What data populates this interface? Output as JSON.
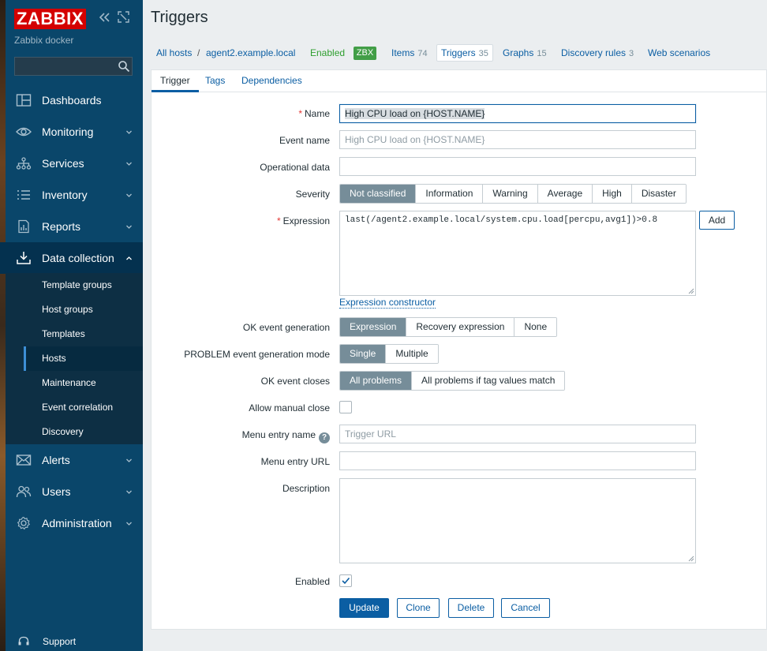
{
  "sidebar": {
    "logo": "ZABBIX",
    "server_name": "Zabbix docker",
    "search_value": "",
    "items": [
      {
        "label": "Dashboards"
      },
      {
        "label": "Monitoring"
      },
      {
        "label": "Services"
      },
      {
        "label": "Inventory"
      },
      {
        "label": "Reports"
      },
      {
        "label": "Data collection"
      },
      {
        "label": "Alerts"
      },
      {
        "label": "Users"
      },
      {
        "label": "Administration"
      }
    ],
    "data_collection_sub": [
      {
        "label": "Template groups"
      },
      {
        "label": "Host groups"
      },
      {
        "label": "Templates"
      },
      {
        "label": "Hosts"
      },
      {
        "label": "Maintenance"
      },
      {
        "label": "Event correlation"
      },
      {
        "label": "Discovery"
      }
    ],
    "support": "Support"
  },
  "page": {
    "title": "Triggers"
  },
  "breadcrumbs": {
    "all_hosts": "All hosts",
    "separator": "/",
    "host": "agent2.example.local",
    "enabled": "Enabled",
    "zbx": "ZBX",
    "items": {
      "label": "Items",
      "count": "74"
    },
    "triggers": {
      "label": "Triggers",
      "count": "35"
    },
    "graphs": {
      "label": "Graphs",
      "count": "15"
    },
    "discovery": {
      "label": "Discovery rules",
      "count": "3"
    },
    "web": {
      "label": "Web scenarios"
    }
  },
  "tabs": {
    "trigger": "Trigger",
    "tags": "Tags",
    "dependencies": "Dependencies"
  },
  "form": {
    "required_mark": "*",
    "name": {
      "label": "Name",
      "value": "High CPU load on {HOST.NAME}"
    },
    "event_name": {
      "label": "Event name",
      "placeholder": "High CPU load on {HOST.NAME}"
    },
    "operational_data": {
      "label": "Operational data",
      "value": ""
    },
    "severity": {
      "label": "Severity",
      "options": [
        "Not classified",
        "Information",
        "Warning",
        "Average",
        "High",
        "Disaster"
      ],
      "selected": "Not classified"
    },
    "expression": {
      "label": "Expression",
      "value": "last(/agent2.example.local/system.cpu.load[percpu,avg1])>0.8",
      "add_button": "Add",
      "constructor_link": "Expression constructor"
    },
    "ok_event_generation": {
      "label": "OK event generation",
      "options": [
        "Expression",
        "Recovery expression",
        "None"
      ],
      "selected": "Expression"
    },
    "problem_mode": {
      "label": "PROBLEM event generation mode",
      "options": [
        "Single",
        "Multiple"
      ],
      "selected": "Single"
    },
    "ok_event_closes": {
      "label": "OK event closes",
      "options": [
        "All problems",
        "All problems if tag values match"
      ],
      "selected": "All problems"
    },
    "allow_manual_close": {
      "label": "Allow manual close",
      "checked": false
    },
    "menu_entry_name": {
      "label": "Menu entry name",
      "help": "?",
      "placeholder": "Trigger URL"
    },
    "menu_entry_url": {
      "label": "Menu entry URL",
      "value": ""
    },
    "description": {
      "label": "Description",
      "value": ""
    },
    "enabled": {
      "label": "Enabled",
      "checked": true
    },
    "buttons": {
      "update": "Update",
      "clone": "Clone",
      "delete": "Delete",
      "cancel": "Cancel"
    }
  }
}
